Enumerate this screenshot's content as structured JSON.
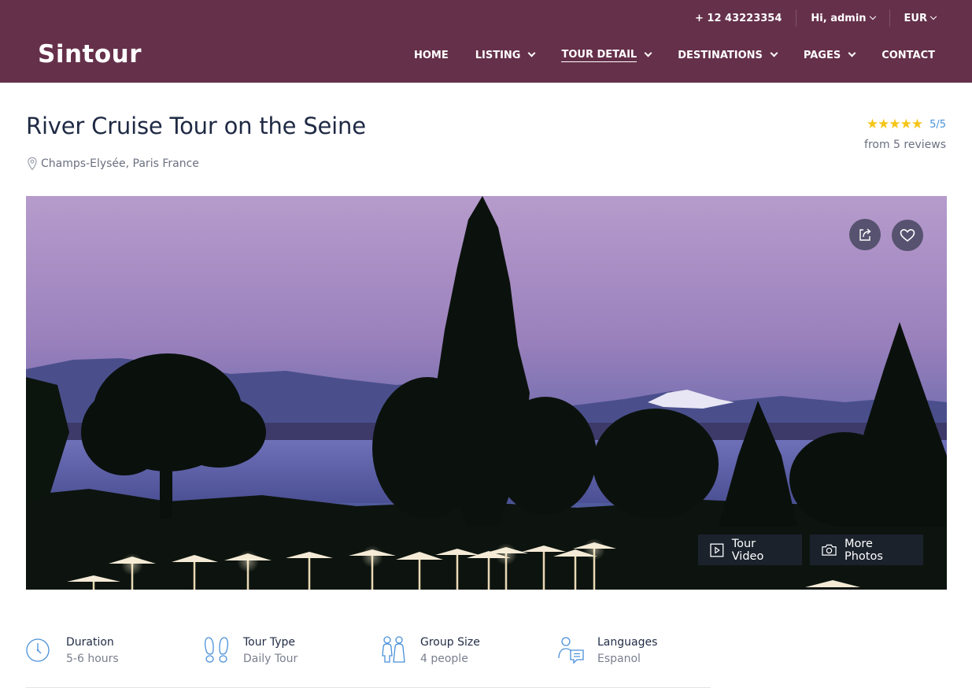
{
  "topbar": {
    "phone": "+ 12 43223354",
    "user": "Hi, admin",
    "currency": "EUR"
  },
  "logo": "Sintour",
  "nav": [
    {
      "label": "HOME",
      "has_menu": false,
      "active": false
    },
    {
      "label": "LISTING",
      "has_menu": true,
      "active": false
    },
    {
      "label": "TOUR DETAIL",
      "has_menu": true,
      "active": true
    },
    {
      "label": "DESTINATIONS",
      "has_menu": true,
      "active": false
    },
    {
      "label": "PAGES",
      "has_menu": true,
      "active": false
    },
    {
      "label": "CONTACT",
      "has_menu": false,
      "active": false
    }
  ],
  "tour": {
    "title": "River Cruise Tour on the Seine",
    "location": "Champs-Elysée, Paris France",
    "stars": 5,
    "rating": "5/5",
    "reviews": "from 5 reviews"
  },
  "hero": {
    "share_icon": "share-icon",
    "favorite_icon": "heart-icon",
    "video_label": "Tour Video",
    "photos_label": "More Photos"
  },
  "facts": [
    {
      "icon": "clock-icon",
      "label": "Duration",
      "value": "5-6 hours"
    },
    {
      "icon": "footprints-icon",
      "label": "Tour Type",
      "value": "Daily Tour"
    },
    {
      "icon": "people-icon",
      "label": "Group Size",
      "value": "4 people"
    },
    {
      "icon": "chat-user-icon",
      "label": "Languages",
      "value": "Espanol"
    }
  ],
  "colors": {
    "header": "#65304a",
    "star": "#f5c518",
    "rating_link": "#4a90d9",
    "icon_blue": "#4a90d9"
  }
}
